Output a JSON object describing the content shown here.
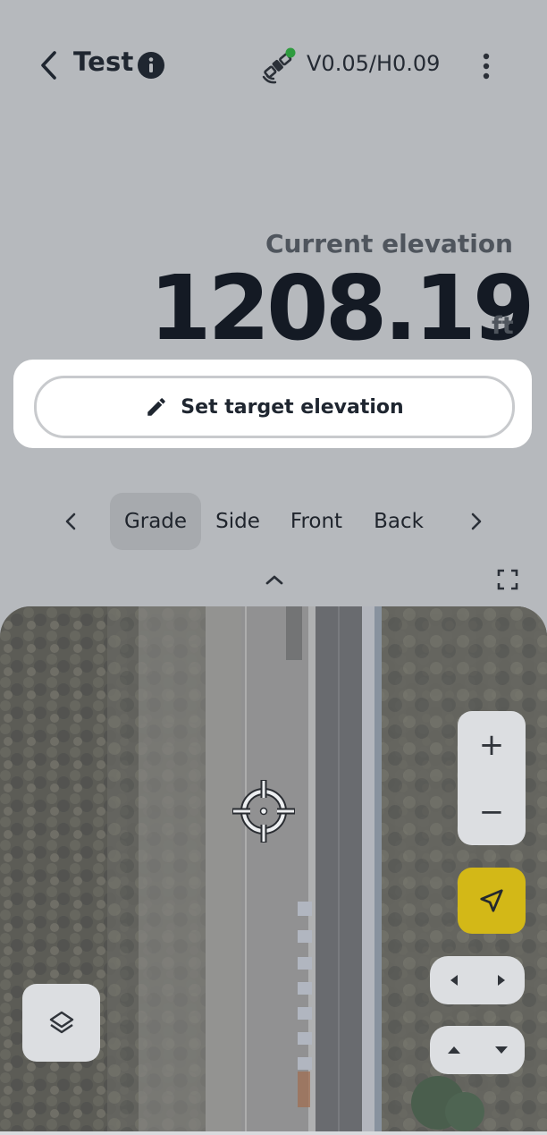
{
  "header": {
    "title": "Test",
    "accuracy": "V0.05/H0.09",
    "icons": {
      "back": "chevron-left-icon",
      "info": "info-icon",
      "gps": "satellite-icon",
      "menu": "more-vertical-icon"
    },
    "gps_status_color": "#2e9b3e"
  },
  "elevation": {
    "label": "Current elevation",
    "value": "1208.19",
    "unit": "ft"
  },
  "target": {
    "button_label": "Set target elevation",
    "icon": "pencil-icon"
  },
  "views": {
    "tabs": [
      "Grade",
      "Side",
      "Front",
      "Back"
    ],
    "selected": "Grade"
  },
  "map": {
    "controls": {
      "zoom_in": "+",
      "zoom_out": "−"
    },
    "locate_color": "#d3b817"
  }
}
